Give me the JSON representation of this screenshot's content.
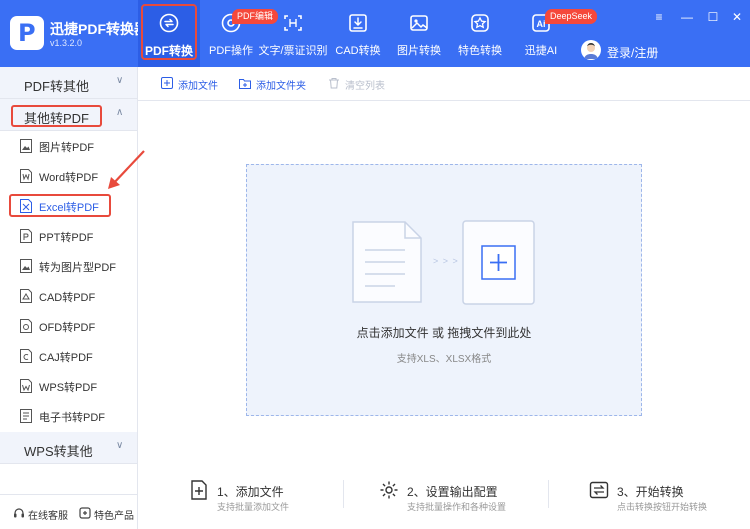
{
  "app": {
    "name": "迅捷PDF转换器",
    "version": "v1.3.2.0"
  },
  "nav": {
    "items": [
      {
        "label": "PDF转换",
        "icon": "convert-icon",
        "active": true
      },
      {
        "label": "PDF操作",
        "icon": "pdf-operate-icon"
      },
      {
        "label": "文字/票证识别",
        "icon": "ocr-scan-icon"
      },
      {
        "label": "CAD转换",
        "icon": "cad-icon"
      },
      {
        "label": "图片转换",
        "icon": "image-icon"
      },
      {
        "label": "特色转换",
        "icon": "star-icon"
      },
      {
        "label": "迅捷AI",
        "icon": "ai-icon"
      }
    ],
    "badges": {
      "pdf_edit": "PDF编辑",
      "deepseek": "DeepSeek"
    },
    "login": "登录/注册"
  },
  "window_controls": {
    "menu": "≡",
    "minimize": "—",
    "maximize": "☐",
    "close": "✕"
  },
  "sidebar": {
    "groups": [
      {
        "label": "PDF转其他",
        "chevron": "∨"
      },
      {
        "label": "其他转PDF",
        "chevron": "∧"
      },
      {
        "label": "WPS转其他",
        "chevron": "∨"
      }
    ],
    "items": [
      {
        "label": "图片转PDF",
        "icon": "image-file-icon"
      },
      {
        "label": "Word转PDF",
        "icon": "word-file-icon"
      },
      {
        "label": "Excel转PDF",
        "icon": "excel-file-icon",
        "selected": true
      },
      {
        "label": "PPT转PDF",
        "icon": "ppt-file-icon"
      },
      {
        "label": "转为图片型PDF",
        "icon": "image-pdf-icon"
      },
      {
        "label": "CAD转PDF",
        "icon": "cad-file-icon"
      },
      {
        "label": "OFD转PDF",
        "icon": "ofd-file-icon"
      },
      {
        "label": "CAJ转PDF",
        "icon": "caj-file-icon"
      },
      {
        "label": "WPS转PDF",
        "icon": "wps-file-icon"
      },
      {
        "label": "电子书转PDF",
        "icon": "ebook-file-icon"
      }
    ],
    "footer": {
      "service": "在线客服",
      "features": "特色产品"
    }
  },
  "toolbar": {
    "add_file": "添加文件",
    "add_folder": "添加文件夹",
    "clear_list": "清空列表"
  },
  "dropzone": {
    "arrows": "> > >",
    "main_text": "点击添加文件 或 拖拽文件到此处",
    "sub_text": "支持XLS、XLSX格式"
  },
  "steps": [
    {
      "title": "1、添加文件",
      "sub": "支持批量添加文件",
      "icon": "add-file-icon"
    },
    {
      "title": "2、设置输出配置",
      "sub": "支持批量操作和各种设置",
      "icon": "settings-gear-icon"
    },
    {
      "title": "3、开始转换",
      "sub": "点击转换按钮开始转换",
      "icon": "start-convert-icon"
    }
  ],
  "colors": {
    "brand": "#3a6ff4",
    "brand_dark": "#2c5ee6",
    "highlight": "#e84a3c",
    "badge": "#f5483b",
    "dropzone_bg": "#eef3fc"
  }
}
